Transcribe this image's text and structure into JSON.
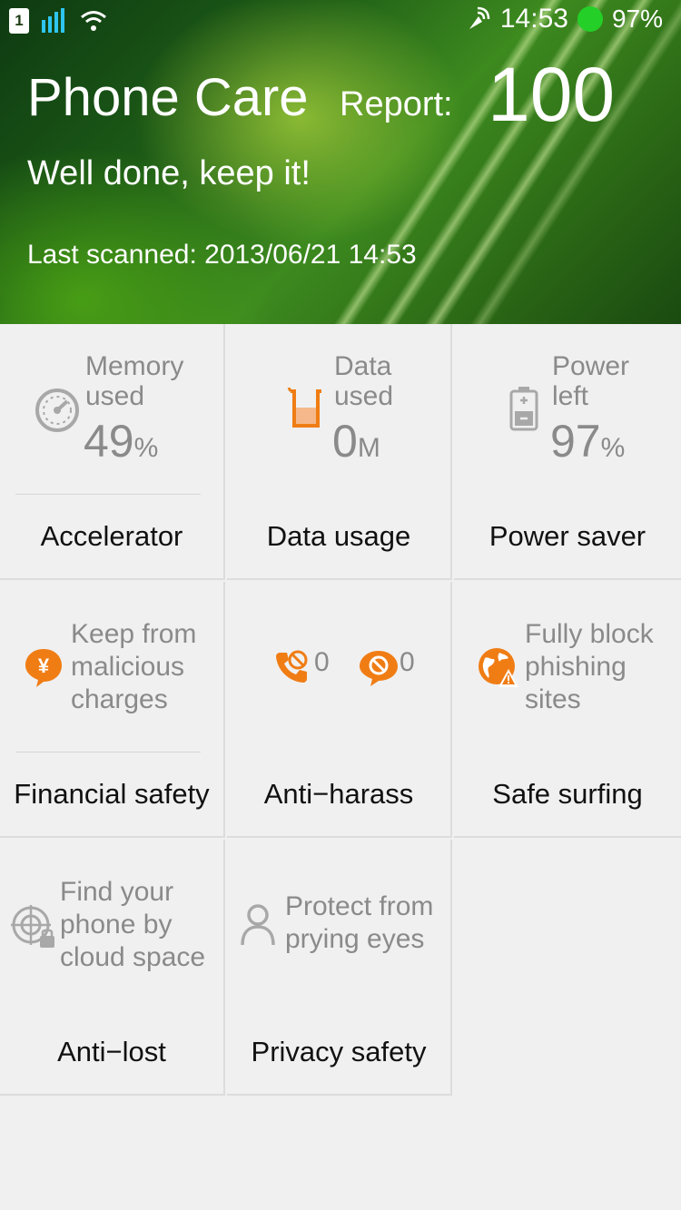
{
  "status_bar": {
    "sim": "1",
    "time": "14:53",
    "battery": "97%"
  },
  "header": {
    "title": "Phone Care",
    "report_label": "Report:",
    "score": "100",
    "subtitle": "Well done, keep it!",
    "last_scanned": "Last scanned: 2013/06/21 14:53"
  },
  "colors": {
    "accent": "#f07d14",
    "gray_text": "#8a8a8a",
    "status_green": "#24d028"
  },
  "tiles": {
    "accelerator": {
      "label_1": "Memory",
      "label_2": "used",
      "value": "49",
      "unit": "%",
      "name": "Accelerator",
      "icon": "speedometer-icon"
    },
    "data_usage": {
      "label_1": "Data",
      "label_2": "used",
      "value": "0",
      "unit": "M",
      "name": "Data usage",
      "icon": "beaker-icon"
    },
    "power_saver": {
      "label_1": "Power",
      "label_2": "left",
      "value": "97",
      "unit": "%",
      "name": "Power saver",
      "icon": "battery-icon"
    },
    "financial_safety": {
      "desc": [
        "Keep from",
        "malicious",
        "charges"
      ],
      "name": "Financial safety",
      "icon": "yen-shield-icon"
    },
    "anti_harass": {
      "calls_blocked": "0",
      "sms_blocked": "0",
      "name": "Anti−harass",
      "icon": "block-call-icon"
    },
    "safe_surfing": {
      "desc": [
        "Fully block",
        "phishing",
        "sites"
      ],
      "name": "Safe surfing",
      "icon": "globe-warning-icon"
    },
    "anti_lost": {
      "desc": [
        "Find your",
        "phone by",
        "cloud space"
      ],
      "name": "Anti−lost",
      "icon": "locate-lock-icon"
    },
    "privacy_safety": {
      "desc": [
        "Protect from",
        "prying eyes"
      ],
      "name": "Privacy safety",
      "icon": "user-icon"
    }
  }
}
